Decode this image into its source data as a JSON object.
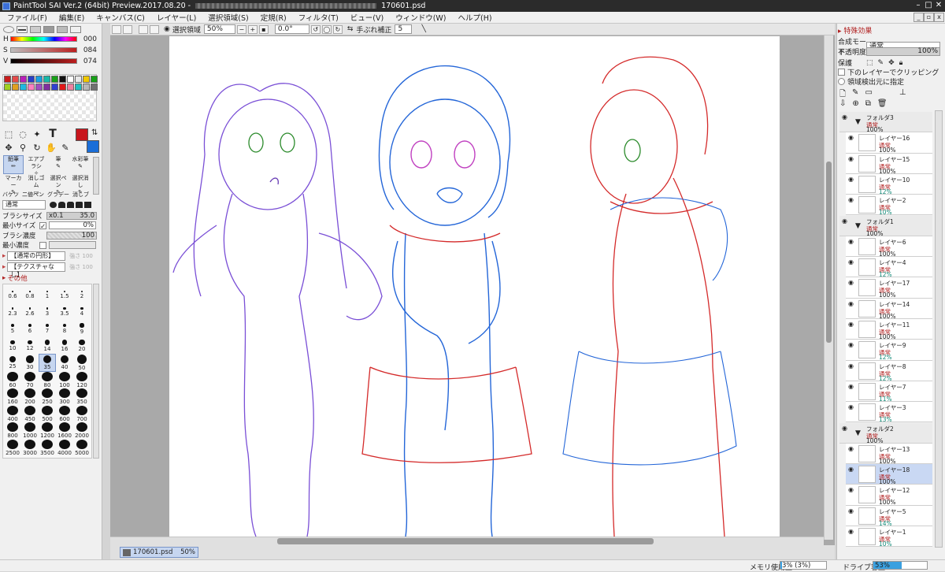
{
  "app": {
    "title": "PaintTool SAI Ver.2 (64bit) Preview.2017.08.20 -",
    "file": "170601.psd"
  },
  "menu": [
    "ファイル(F)",
    "編集(E)",
    "キャンバス(C)",
    "レイヤー(L)",
    "選択領域(S)",
    "定規(R)",
    "フィルタ(T)",
    "ビュー(V)",
    "ウィンドウ(W)",
    "ヘルプ(H)"
  ],
  "toolbar": {
    "selection_label": "選択領域",
    "zoom": "50%",
    "angle": "0.0°",
    "stabilizer_label": "手ぶれ補正",
    "stabilizer_value": "5"
  },
  "color": {
    "h_label": "H",
    "h_value": "000",
    "s_label": "S",
    "s_value": "084",
    "v_label": "V",
    "v_value": "074",
    "primary": "#c8161d",
    "secondary": "#1a6ed8"
  },
  "palette": [
    "#c81c1c",
    "#e44a4a",
    "#b81fb8",
    "#2a3fc6",
    "#1aa0e0",
    "#1ab8a8",
    "#18a018",
    "#111111",
    "#ffffff",
    "#e8e8e8",
    "#f0c800",
    "#18a018",
    "#a0d020",
    "#e0a020",
    "#20b8e0",
    "#ff80c0",
    "#a050c0",
    "#8030a0",
    "#3040d0",
    "#e01818",
    "#f080a0",
    "#20c0c0",
    "#b8b8b8",
    "#707070"
  ],
  "brush_tools": [
    {
      "label": "鉛筆"
    },
    {
      "label": "エアブラシ"
    },
    {
      "label": "筆"
    },
    {
      "label": "水彩筆"
    },
    {
      "label": "マーカー"
    },
    {
      "label": "消しゴム"
    },
    {
      "label": "選択ペン"
    },
    {
      "label": "選択消し"
    },
    {
      "label": "バケツ"
    },
    {
      "label": "二値ペン"
    },
    {
      "label": "グラデー"
    },
    {
      "label": "消しブ"
    }
  ],
  "brush": {
    "mode": "通常",
    "size_label": "ブラシサイズ",
    "size_mult": "x0.1",
    "size_value": "35.0",
    "min_size_label": "最小サイズ",
    "min_size_value": "0%",
    "density_label": "ブラシ濃度",
    "density_value": "100",
    "min_density_label": "最小濃度",
    "shape": "【通常の円形】",
    "texture": "【テクスチャなし】",
    "shape_strength": "強さ 100",
    "texture_strength": "強さ 100",
    "other_label": "その他"
  },
  "brush_sizes": [
    "0.6",
    "0.8",
    "1",
    "1.5",
    "2",
    "2.3",
    "2.6",
    "3",
    "3.5",
    "4",
    "5",
    "6",
    "7",
    "8",
    "9",
    "10",
    "12",
    "14",
    "16",
    "20",
    "25",
    "30",
    "35",
    "40",
    "50",
    "60",
    "70",
    "80",
    "100",
    "120",
    "160",
    "200",
    "250",
    "300",
    "350",
    "400",
    "450",
    "500",
    "600",
    "700",
    "800",
    "1000",
    "1200",
    "1600",
    "2000",
    "2500",
    "3000",
    "3500",
    "4000",
    "5000"
  ],
  "selected_size": "35",
  "doc_tab": {
    "name": "170601.psd",
    "zoom": "50%"
  },
  "status": {
    "memory_label": "メモリ使用量",
    "memory_value": "3% (3%)",
    "drive_label": "ドライブ容量",
    "drive_value": "53%",
    "memory_pct": 3,
    "drive_pct": 53
  },
  "right": {
    "effects_label": "特殊効果",
    "blend_label": "合成モード",
    "blend_value": "通常",
    "opacity_label": "不透明度",
    "opacity_value": "100%",
    "protect_label": "保護",
    "clip_label": "下のレイヤーでクリッピング",
    "ref_label": "領域検出元に指定"
  },
  "layers": [
    {
      "name": "フォルダ3",
      "mode": "通常",
      "opacity": "100%",
      "folder": true
    },
    {
      "name": "レイヤー16",
      "mode": "通常",
      "opacity": "100%",
      "teal": false
    },
    {
      "name": "レイヤー15",
      "mode": "通常",
      "opacity": "100%",
      "teal": false
    },
    {
      "name": "レイヤー10",
      "mode": "通常",
      "opacity": "12%",
      "teal": true
    },
    {
      "name": "レイヤー2",
      "mode": "通常",
      "opacity": "10%",
      "teal": true
    },
    {
      "name": "フォルダ1",
      "mode": "通常",
      "opacity": "100%",
      "folder": true
    },
    {
      "name": "レイヤー6",
      "mode": "通常",
      "opacity": "100%",
      "teal": false
    },
    {
      "name": "レイヤー4",
      "mode": "通常",
      "opacity": "12%",
      "teal": true
    },
    {
      "name": "レイヤー17",
      "mode": "通常",
      "opacity": "100%",
      "teal": false
    },
    {
      "name": "レイヤー14",
      "mode": "通常",
      "opacity": "100%",
      "teal": false
    },
    {
      "name": "レイヤー11",
      "mode": "通常",
      "opacity": "100%",
      "teal": false
    },
    {
      "name": "レイヤー9",
      "mode": "通常",
      "opacity": "12%",
      "teal": true
    },
    {
      "name": "レイヤー8",
      "mode": "通常",
      "opacity": "12%",
      "teal": true
    },
    {
      "name": "レイヤー7",
      "mode": "通常",
      "opacity": "11%",
      "teal": true
    },
    {
      "name": "レイヤー3",
      "mode": "通常",
      "opacity": "13%",
      "teal": true
    },
    {
      "name": "フォルダ2",
      "mode": "通常",
      "opacity": "100%",
      "folder": true
    },
    {
      "name": "レイヤー13",
      "mode": "通常",
      "opacity": "100%",
      "teal": false
    },
    {
      "name": "レイヤー18",
      "mode": "通常",
      "opacity": "100%",
      "teal": false,
      "selected": true
    },
    {
      "name": "レイヤー12",
      "mode": "通常",
      "opacity": "100%",
      "teal": false
    },
    {
      "name": "レイヤー5",
      "mode": "通常",
      "opacity": "14%",
      "teal": true
    },
    {
      "name": "レイヤー1",
      "mode": "通常",
      "opacity": "10%",
      "teal": true
    }
  ]
}
